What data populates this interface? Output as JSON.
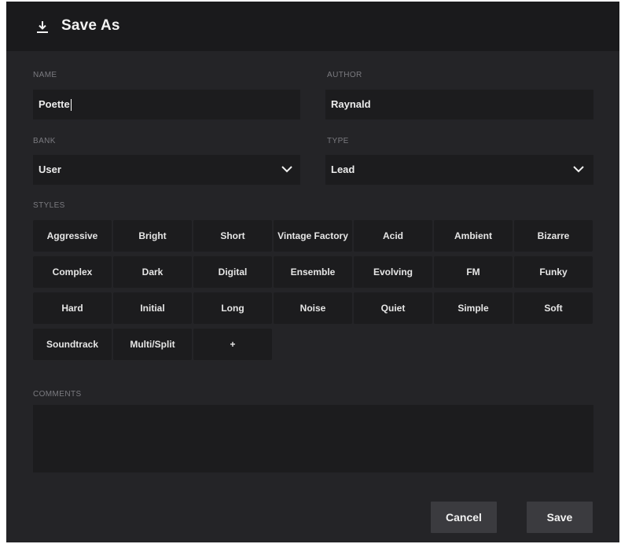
{
  "dialog": {
    "title": "Save As",
    "icon": "download-icon"
  },
  "name": {
    "label": "NAME",
    "value": "Poette"
  },
  "author": {
    "label": "AUTHOR",
    "value": "Raynald"
  },
  "bank": {
    "label": "BANK",
    "value": "User"
  },
  "type": {
    "label": "TYPE",
    "value": "Lead"
  },
  "styles": {
    "label": "STYLES",
    "items": [
      "Aggressive",
      "Bright",
      "Short",
      "Vintage Factory",
      "Acid",
      "Ambient",
      "Bizarre",
      "Complex",
      "Dark",
      "Digital",
      "Ensemble",
      "Evolving",
      "FM",
      "Funky",
      "Hard",
      "Initial",
      "Long",
      "Noise",
      "Quiet",
      "Simple",
      "Soft",
      "Soundtrack",
      "Multi/Split",
      "+"
    ]
  },
  "comments": {
    "label": "COMMENTS",
    "value": ""
  },
  "buttons": {
    "cancel": "Cancel",
    "save": "Save"
  },
  "colors": {
    "background": "#242427",
    "header": "#1a1a1c",
    "field": "#1c1c1e",
    "button": "#3b3b3f"
  }
}
